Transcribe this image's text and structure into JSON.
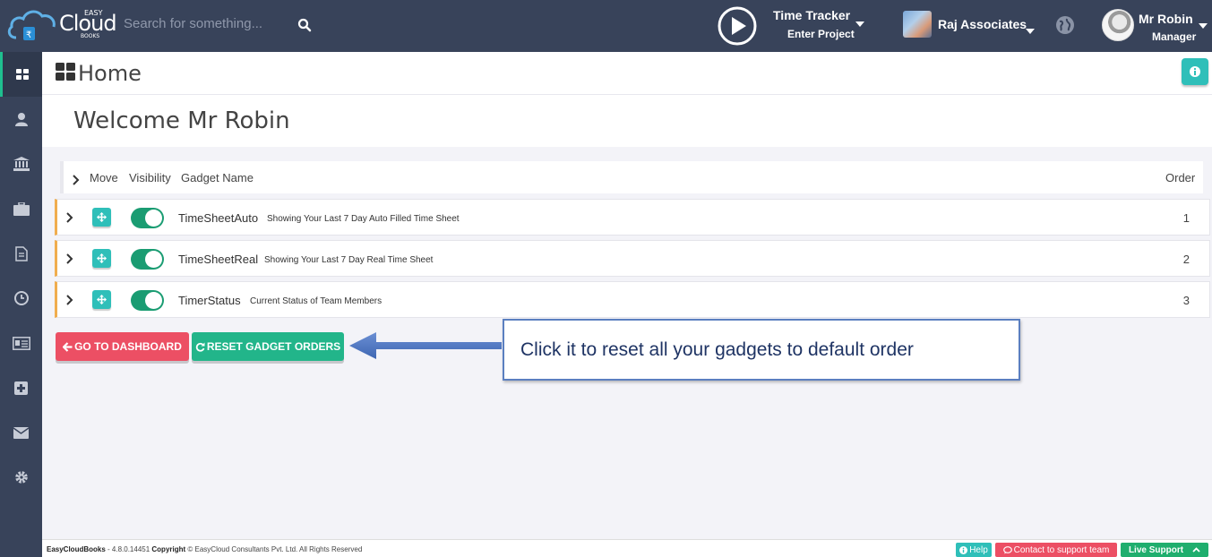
{
  "topbar": {
    "logo": {
      "easy": "EASY",
      "cloud": "Cloud",
      "books": "BOOKS"
    },
    "search_placeholder": "Search for something...",
    "time_tracker": {
      "title": "Time Tracker",
      "subtitle": "Enter Project"
    },
    "company": "Raj Associates",
    "user": {
      "name": "Mr Robin",
      "role": "Manager"
    }
  },
  "sidebar": {
    "items": [
      {
        "icon": "dashboard-icon",
        "active": true
      },
      {
        "icon": "user-icon"
      },
      {
        "icon": "bank-icon"
      },
      {
        "icon": "briefcase-icon"
      },
      {
        "icon": "document-icon"
      },
      {
        "icon": "clock-icon"
      },
      {
        "icon": "id-card-icon"
      },
      {
        "icon": "plus-square-icon"
      },
      {
        "icon": "envelope-icon"
      },
      {
        "icon": "gear-icon"
      }
    ]
  },
  "page": {
    "title": "Home",
    "welcome": "Welcome Mr Robin"
  },
  "table": {
    "headers": {
      "move": "Move",
      "visibility": "Visibility",
      "name": "Gadget Name",
      "order": "Order"
    },
    "rows": [
      {
        "name": "TimeSheetAuto",
        "desc": "Showing Your Last 7 Day Auto Filled Time Sheet",
        "order": "1",
        "visible": true
      },
      {
        "name": "TimeSheetReal",
        "desc": "Showing Your Last 7 Day Real Time Sheet",
        "order": "2",
        "visible": true
      },
      {
        "name": "TimerStatus",
        "desc": "Current Status of Team Members",
        "order": "3",
        "visible": true
      }
    ]
  },
  "buttons": {
    "dashboard": "GO TO DASHBOARD",
    "reset": "RESET GADGET ORDERS"
  },
  "callout": "Click it to reset all your gadgets to default order",
  "footer": {
    "brand": "EasyCloudBooks",
    "version": " - 4.8.0.14451 ",
    "copyright_label": "Copyright",
    "copyright": " © EasyCloud Consultants Pvt. Ltd. All Rights Reserved",
    "help": "Help",
    "contact": "Contact to support team",
    "live": "Live Support"
  },
  "colors": {
    "topbar": "#38435a",
    "teal": "#2fbfb9",
    "green": "#22b58a",
    "red": "#ec4f64",
    "row_accent": "#f0ad4e"
  }
}
